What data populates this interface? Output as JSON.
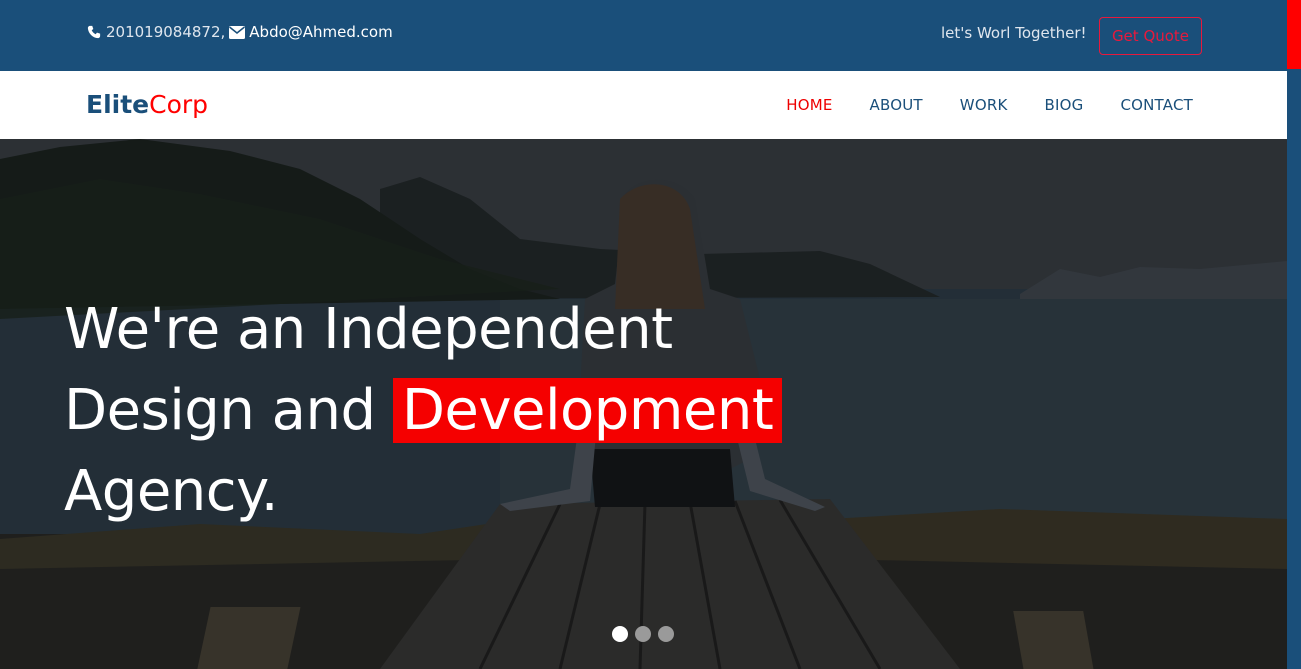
{
  "topbar": {
    "phone": "201019084872,",
    "email": "Abdo@Ahmed.com",
    "tagline": "let's Worl Together!",
    "quote_label": "Get Quote",
    "phone_icon": "phone-icon",
    "email_icon": "envelope-icon"
  },
  "brand": {
    "part1": "Elite",
    "part2": "Corp"
  },
  "nav": {
    "items": [
      {
        "label": "HOME",
        "active": true
      },
      {
        "label": "ABOUT",
        "active": false
      },
      {
        "label": "WORK",
        "active": false
      },
      {
        "label": "BIOG",
        "active": false
      },
      {
        "label": "CONTACT",
        "active": false
      }
    ]
  },
  "hero": {
    "line1": "We're an Independent",
    "line2_pre": "Design and ",
    "line2_highlight": "Development",
    "line3": "Agency.",
    "slides_total": 3,
    "active_slide": 1
  },
  "colors": {
    "primary": "#1a4f7a",
    "accent": "#f00000",
    "quote_border": "#e8193c"
  }
}
